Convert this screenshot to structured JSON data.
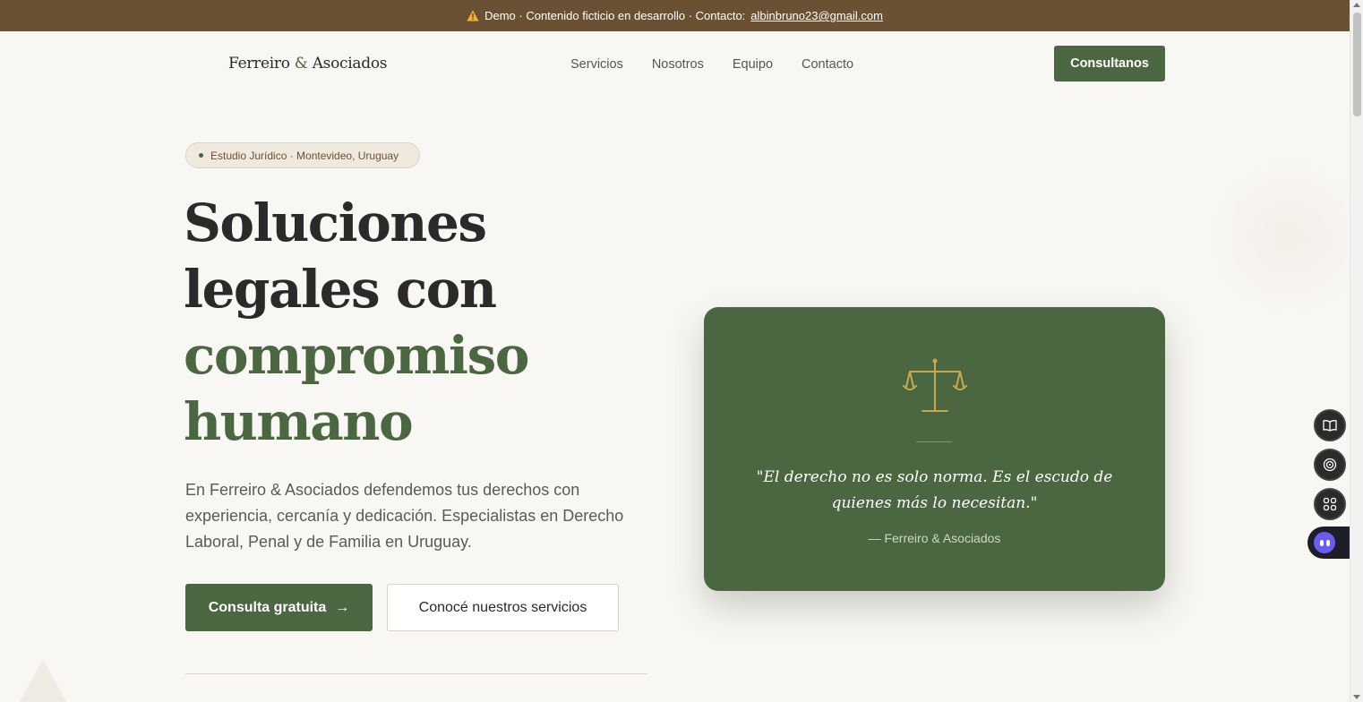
{
  "banner": {
    "text": "Demo · Contenido ficticio en desarrollo · Contacto:",
    "email": "albinbruno23@gmail.com",
    "icon": "warning-icon"
  },
  "nav": {
    "logo_left": "Ferreiro",
    "logo_amp": "&",
    "logo_right": "Asociados",
    "items": [
      "Servicios",
      "Nosotros",
      "Equipo",
      "Contacto"
    ],
    "cta": "Consultanos"
  },
  "hero": {
    "pill": "Estudio Jurídico · Montevideo, Uruguay",
    "title_lines": [
      "Soluciones",
      "legales con",
      "compromiso",
      "humano"
    ],
    "lead": "En Ferreiro & Asociados defendemos tus derechos con experiencia, cercanía y dedicación. Especialistas en Derecho Laboral, Penal y de Familia en Uruguay.",
    "primary_button": "Consulta gratuita",
    "primary_arrow": "→",
    "secondary_button": "Conocé nuestros servicios"
  },
  "card": {
    "icon": "scales-of-justice-icon",
    "quote": "\"El derecho no es solo norma. Es el escudo de quienes más lo necesitan.\"",
    "author": "— Ferreiro & Asociados"
  },
  "side_tools": [
    "book-icon",
    "broadcast-icon",
    "apps-grid-icon"
  ],
  "colors": {
    "brand_green": "#4a6741",
    "banner_brown": "#6b5133",
    "background": "#f9f7f3",
    "gold": "#c9a84c"
  }
}
